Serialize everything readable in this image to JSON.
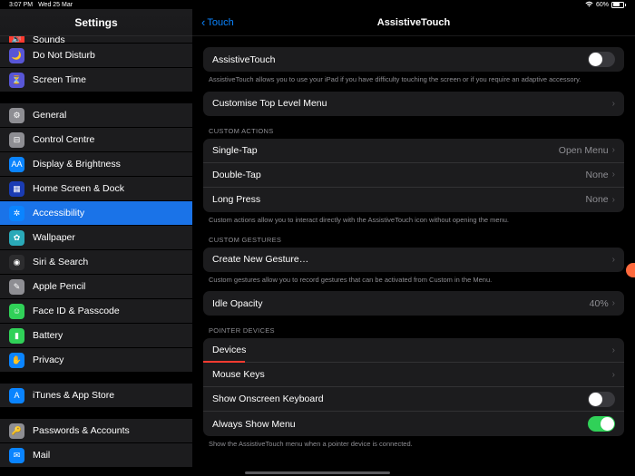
{
  "status": {
    "time": "3:07 PM",
    "date": "Wed 25 Mar",
    "battery": "60%"
  },
  "sidebar": {
    "title": "Settings",
    "sections": [
      [
        {
          "label": "Sounds",
          "icon_bg": "#ff3b30"
        },
        {
          "label": "Do Not Disturb",
          "icon_bg": "#5856d6"
        },
        {
          "label": "Screen Time",
          "icon_bg": "#5856d6"
        }
      ],
      [
        {
          "label": "General",
          "icon_bg": "#8e8e93"
        },
        {
          "label": "Control Centre",
          "icon_bg": "#8e8e93"
        },
        {
          "label": "Display & Brightness",
          "icon_bg": "#0a84ff"
        },
        {
          "label": "Home Screen & Dock",
          "icon_bg": "#1a3cb4"
        },
        {
          "label": "Accessibility",
          "icon_bg": "#0a84ff",
          "selected": true
        },
        {
          "label": "Wallpaper",
          "icon_bg": "#2aa9b8"
        },
        {
          "label": "Siri & Search",
          "icon_bg": "#2c2c2e"
        },
        {
          "label": "Apple Pencil",
          "icon_bg": "#8e8e93"
        },
        {
          "label": "Face ID & Passcode",
          "icon_bg": "#30d158"
        },
        {
          "label": "Battery",
          "icon_bg": "#30d158"
        },
        {
          "label": "Privacy",
          "icon_bg": "#0a84ff"
        }
      ],
      [
        {
          "label": "iTunes & App Store",
          "icon_bg": "#0a84ff"
        }
      ],
      [
        {
          "label": "Passwords & Accounts",
          "icon_bg": "#8e8e93"
        },
        {
          "label": "Mail",
          "icon_bg": "#0a84ff"
        }
      ]
    ]
  },
  "main": {
    "back": "Touch",
    "title": "AssistiveTouch",
    "at": {
      "label": "AssistiveTouch",
      "on": false,
      "desc": "AssistiveTouch allows you to use your iPad if you have difficulty touching the screen or if you require an adaptive accessory."
    },
    "customise": "Customise Top Level Menu",
    "custom_actions": {
      "head": "CUSTOM ACTIONS",
      "single": {
        "label": "Single-Tap",
        "value": "Open Menu"
      },
      "double": {
        "label": "Double-Tap",
        "value": "None"
      },
      "long": {
        "label": "Long Press",
        "value": "None"
      },
      "foot": "Custom actions allow you to interact directly with the AssistiveTouch icon without opening the menu."
    },
    "custom_gestures": {
      "head": "CUSTOM GESTURES",
      "create": "Create New Gesture…",
      "foot": "Custom gestures allow you to record gestures that can be activated from Custom in the Menu."
    },
    "idle": {
      "label": "Idle Opacity",
      "value": "40%"
    },
    "pointer": {
      "head": "POINTER DEVICES",
      "devices": "Devices",
      "mouse_keys": "Mouse Keys",
      "onscreen_kb": {
        "label": "Show Onscreen Keyboard",
        "on": false
      },
      "always_menu": {
        "label": "Always Show Menu",
        "on": true
      },
      "foot": "Show the AssistiveTouch menu when a pointer device is connected."
    }
  }
}
